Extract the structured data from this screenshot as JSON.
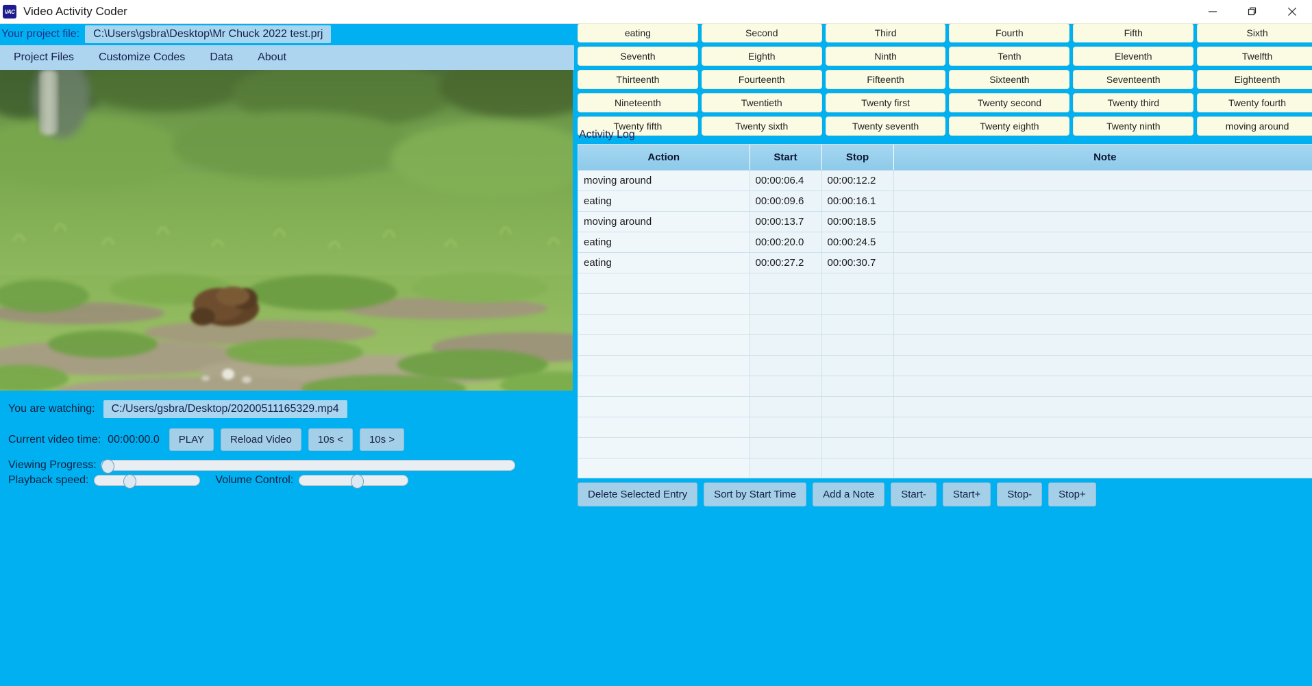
{
  "window": {
    "title": "Video Activity Coder",
    "icon": "app-icon",
    "minimize": "minimize-icon",
    "maximize": "restore-icon",
    "close": "close-icon"
  },
  "project": {
    "label": "Your project file:",
    "path": "C:\\Users\\gsbra\\Desktop\\Mr Chuck 2022 test.prj"
  },
  "menu": {
    "items": [
      {
        "label": "Project Files"
      },
      {
        "label": "Customize Codes"
      },
      {
        "label": "Data"
      },
      {
        "label": "About"
      }
    ]
  },
  "codes": {
    "buttons": [
      "eating",
      "Second",
      "Third",
      "Fourth",
      "Fifth",
      "Sixth",
      "Seventh",
      "Eighth",
      "Ninth",
      "Tenth",
      "Eleventh",
      "Twelfth",
      "Thirteenth",
      "Fourteenth",
      "Fifteenth",
      "Sixteenth",
      "Seventeenth",
      "Eighteenth",
      "Nineteenth",
      "Twentieth",
      "Twenty first",
      "Twenty second",
      "Twenty third",
      "Twenty fourth",
      "Twenty fifth",
      "Twenty sixth",
      "Twenty seventh",
      "Twenty eighth",
      "Twenty ninth",
      "moving around"
    ]
  },
  "activity_log": {
    "title": "Activity Log",
    "columns": [
      "Action",
      "Start",
      "Stop",
      "Note"
    ],
    "rows": [
      {
        "action": "moving around",
        "start": "00:00:06.4",
        "stop": "00:00:12.2",
        "note": ""
      },
      {
        "action": "eating",
        "start": "00:00:09.6",
        "stop": "00:00:16.1",
        "note": ""
      },
      {
        "action": "moving around",
        "start": "00:00:13.7",
        "stop": "00:00:18.5",
        "note": ""
      },
      {
        "action": "eating",
        "start": "00:00:20.0",
        "stop": "00:00:24.5",
        "note": ""
      },
      {
        "action": "eating",
        "start": "00:00:27.2",
        "stop": "00:00:30.7",
        "note": ""
      },
      {
        "action": "",
        "start": "",
        "stop": "",
        "note": ""
      },
      {
        "action": "",
        "start": "",
        "stop": "",
        "note": ""
      },
      {
        "action": "",
        "start": "",
        "stop": "",
        "note": ""
      },
      {
        "action": "",
        "start": "",
        "stop": "",
        "note": ""
      },
      {
        "action": "",
        "start": "",
        "stop": "",
        "note": ""
      },
      {
        "action": "",
        "start": "",
        "stop": "",
        "note": ""
      },
      {
        "action": "",
        "start": "",
        "stop": "",
        "note": ""
      },
      {
        "action": "",
        "start": "",
        "stop": "",
        "note": ""
      },
      {
        "action": "",
        "start": "",
        "stop": "",
        "note": ""
      },
      {
        "action": "",
        "start": "",
        "stop": "",
        "note": ""
      },
      {
        "action": "",
        "start": "",
        "stop": "",
        "note": ""
      },
      {
        "action": "",
        "start": "",
        "stop": "",
        "note": ""
      },
      {
        "action": "",
        "start": "",
        "stop": "",
        "note": ""
      },
      {
        "action": "",
        "start": "",
        "stop": "",
        "note": ""
      }
    ],
    "buttons": [
      "Delete Selected Entry",
      "Sort by Start Time",
      "Add a Note",
      "Start-",
      "Start+",
      "Stop-",
      "Stop+"
    ]
  },
  "player": {
    "watching_label": "You are watching:",
    "watching_path": "C:/Users/gsbra/Desktop/20200511165329.mp4",
    "time_label": "Current video time:",
    "time_value": "00:00:00.0",
    "play_label": "PLAY",
    "reload_label": "Reload Video",
    "back10_label": "10s <",
    "fwd10_label": "10s >",
    "progress_label": "Viewing Progress:",
    "progress_percent": 0,
    "speed_label": "Playback speed:",
    "speed_percent": 30,
    "volume_label": "Volume Control:",
    "volume_percent": 52
  },
  "colors": {
    "app_background": "#00b0f0",
    "menu_background": "#add5ef",
    "code_button": "#fbfbe4",
    "field_background": "#a8d5ef",
    "table_header": "#8ecaea"
  }
}
